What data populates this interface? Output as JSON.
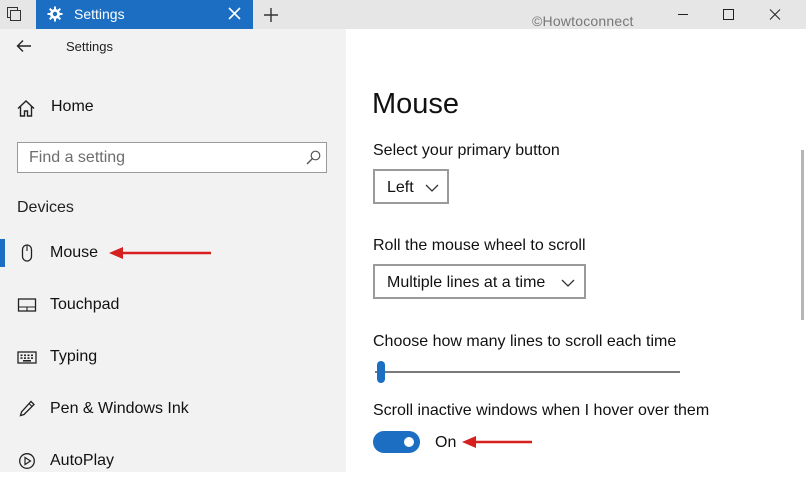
{
  "window": {
    "tab_title": "Settings",
    "watermark": "©Howtoconnect"
  },
  "sidebar": {
    "header_title": "Settings",
    "home_label": "Home",
    "search_placeholder": "Find a setting",
    "group_label": "Devices",
    "items": [
      {
        "label": "Mouse",
        "icon": "mouse-icon",
        "selected": true
      },
      {
        "label": "Touchpad",
        "icon": "touchpad-icon",
        "selected": false
      },
      {
        "label": "Typing",
        "icon": "keyboard-icon",
        "selected": false
      },
      {
        "label": "Pen & Windows Ink",
        "icon": "pen-icon",
        "selected": false
      },
      {
        "label": "AutoPlay",
        "icon": "autoplay-icon",
        "selected": false
      }
    ]
  },
  "main": {
    "title": "Mouse",
    "primary_button_label": "Select your primary button",
    "primary_button_value": "Left",
    "scroll_label": "Roll the mouse wheel to scroll",
    "scroll_value": "Multiple lines at a time",
    "lines_label": "Choose how many lines to scroll each time",
    "inactive_label": "Scroll inactive windows when I hover over them",
    "inactive_state": "On"
  },
  "colors": {
    "accent": "#1b6ec2",
    "annotation_arrow": "#d61f1f"
  }
}
